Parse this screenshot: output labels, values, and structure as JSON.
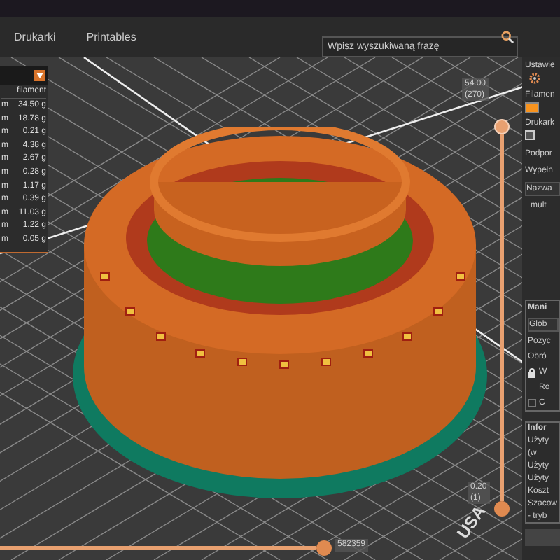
{
  "tabs": [
    {
      "label": "Drukarki",
      "selected": false
    },
    {
      "label": "Printables",
      "selected": false
    }
  ],
  "search": {
    "placeholder": "Wpisz wyszukiwaną frazę"
  },
  "filament_table": {
    "header": "filament",
    "rows": [
      {
        "unit": "m",
        "weight": "34.50 g"
      },
      {
        "unit": "m",
        "weight": "18.78 g"
      },
      {
        "unit": "m",
        "weight": "0.21 g"
      },
      {
        "unit": "m",
        "weight": "4.38 g"
      },
      {
        "unit": "m",
        "weight": "2.67 g"
      },
      {
        "unit": "m",
        "weight": "0.28 g"
      },
      {
        "unit": "m",
        "weight": "1.17 g"
      },
      {
        "unit": "m",
        "weight": "0.39 g"
      },
      {
        "unit": "m",
        "weight": "11.03 g"
      },
      {
        "unit": "m",
        "weight": "1.22 g"
      },
      {
        "unit": "m",
        "weight": "0.05 g"
      }
    ]
  },
  "layer_slider": {
    "top_value": "54.00",
    "top_layer": "(270)",
    "bottom_value": "0.20",
    "bottom_layer": "(1)"
  },
  "move_slider": {
    "label": "582359"
  },
  "bed_logo": "USA",
  "right_panel": {
    "settings": "Ustawie",
    "filament": "Filamen",
    "printer": "Drukark",
    "supports": "Podpor",
    "infill": "Wypełn",
    "name_header": "Nazwa",
    "object_name": "mult",
    "manipulation": {
      "title": "Mani",
      "coordinates": "Glob",
      "position": "Pozyc",
      "rotation": "Obró",
      "world": "W",
      "rotate": "Ro",
      "checkbox_label": "C",
      "checked": false
    },
    "info": {
      "title": "Infor",
      "lines": [
        "Użyty",
        "(w",
        "Użyty",
        "Użyty",
        "Koszt",
        "Szacow",
        "- tryb"
      ]
    }
  }
}
